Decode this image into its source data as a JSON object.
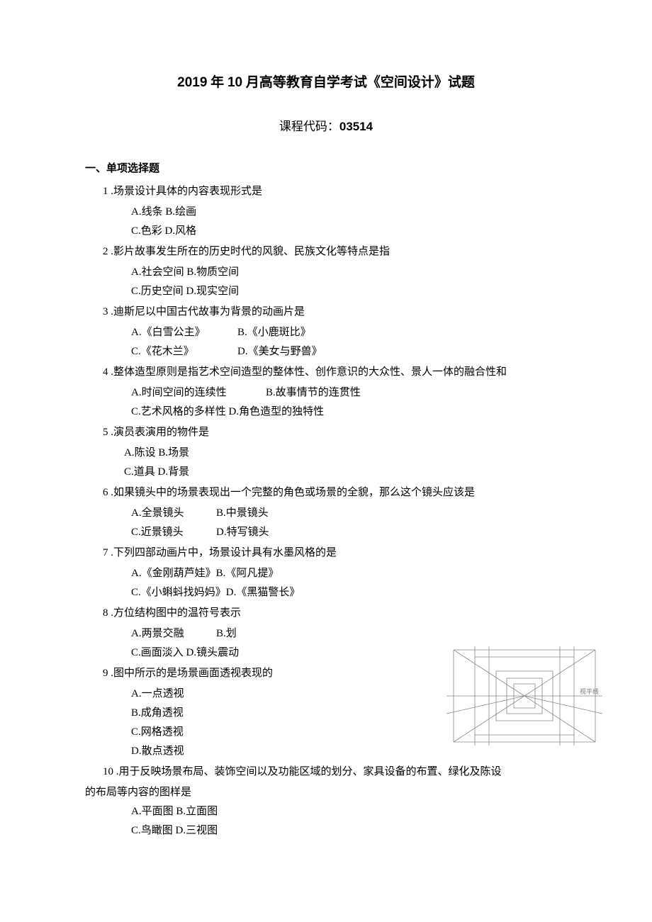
{
  "title_prefix": "2019",
  "title_mid1": " 年 ",
  "title_bold2": "10",
  "title_suffix": " 月高等教育自学考试《空间设计》试题",
  "subtitle_label": "课程代码：",
  "subtitle_code": "03514",
  "section1": "一、单项选择题",
  "q1": {
    "stem": "1   .场景设计具体的内容表现形式是",
    "line1": "A.线条 B.绘画",
    "line2": "C.色彩 D.风格"
  },
  "q2": {
    "stem": "2   .影片故事发生所在的历史时代的风貌、民族文化等特点是指",
    "line1": "A.社会空间 B.物质空间",
    "line2": "C.历史空间 D.现实空间"
  },
  "q3": {
    "stem": "3   .迪斯尼以中国古代故事为背景的动画片是",
    "line1a": "A.《白雪公主》",
    "line1b": "B.《小鹿斑比》",
    "line2a": "C.《花木兰》",
    "line2b": "D.《美女与野兽》"
  },
  "q4": {
    "stem": "4   .整体造型原则是指艺术空间造型的整体性、创作意识的大众性、景人一体的融合性和",
    "line1a": "A.时间空间的连续性",
    "line1b": "B.故事情节的连贯性",
    "line2": "C.艺术风格的多样性 D.角色造型的独特性"
  },
  "q5": {
    "stem": "5   .演员表演用的物件是",
    "line1": "A.陈设 B.场景",
    "line2": "C.道具 D.背景"
  },
  "q6": {
    "stem": "6   .如果镜头中的场景表现出一个完整的角色或场景的全貌，那么这个镜头应该是",
    "line1a": "A.全景镜头",
    "line1b": "B.中景镜头",
    "line2a": "C.近景镜头",
    "line2b": "D.特写镜头"
  },
  "q7": {
    "stem": "7   .下列四部动画片中，场景设计具有水墨风格的是",
    "line1": "A.《金刚葫芦娃》B.《阿凡提》",
    "line2": "C.《小蝌蚪找妈妈》D.《黑猫警长》"
  },
  "q8": {
    "stem": "8   .方位结构图中的温符号表示",
    "line1a": "A.两景交融",
    "line1b": "B.划",
    "line2": "C.画面淡入 D.镜头震动"
  },
  "q9": {
    "stem": "9   .图中所示的是场景画面透视表现的",
    "a": "A.一点透视",
    "b": "B.成角透视",
    "c": "C.网格透视",
    "d": "D.散点透视"
  },
  "q10": {
    "stem1": "10   .用于反映场景布局、装饰空间以及功能区域的划分、家具设备的布置、绿化及陈设",
    "stem2": "的布局等内容的图样是",
    "line1": "A.平面图 B.立面图",
    "line2": "C.鸟瞰图 D.三视图"
  },
  "img_label": "视平线"
}
